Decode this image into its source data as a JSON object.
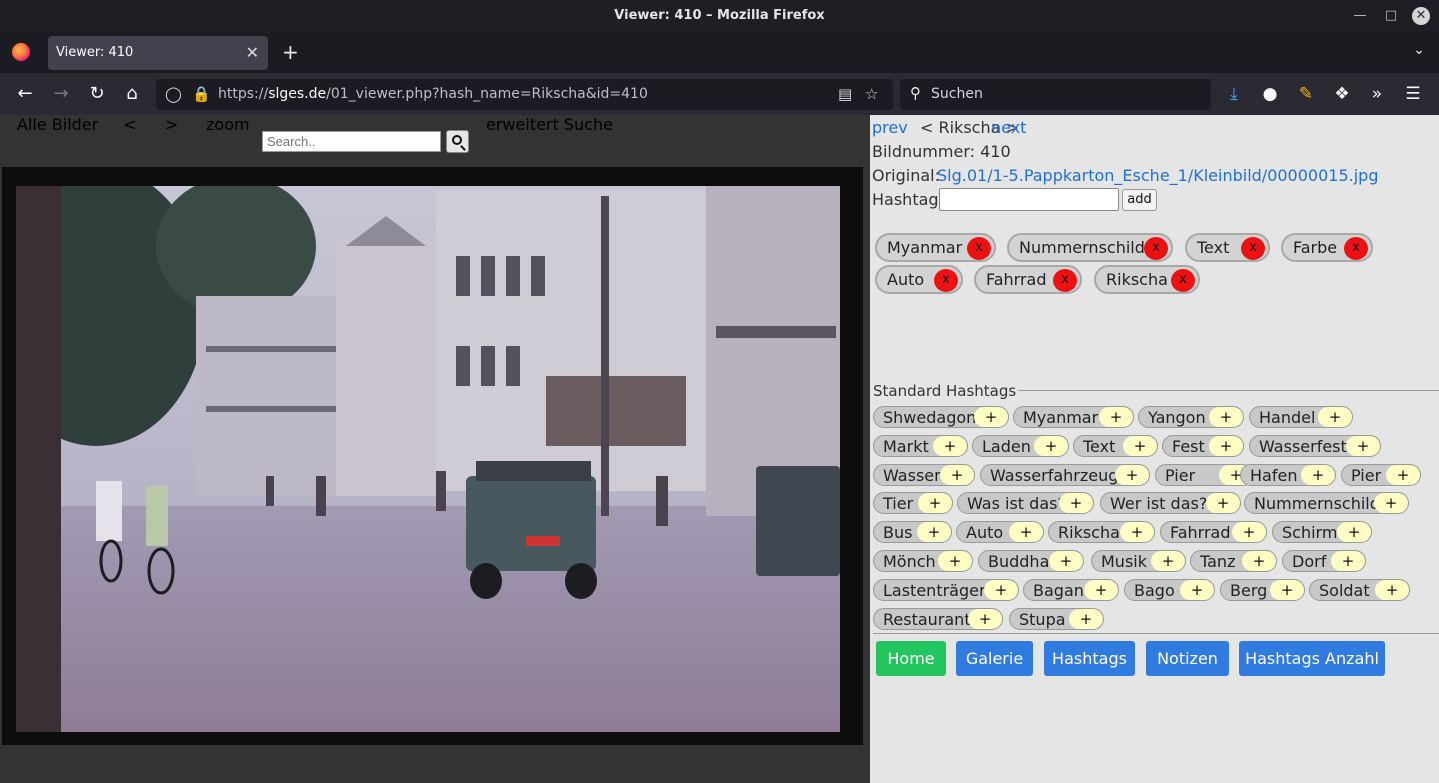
{
  "window": {
    "title": "Viewer: 410 – Mozilla Firefox"
  },
  "tab": {
    "title": "Viewer: 410"
  },
  "address": {
    "prefix": "https://",
    "host": "slges.de",
    "path": "/01_viewer.php?hash_name=Rikscha&id=410"
  },
  "browser_search": {
    "placeholder": "Suchen"
  },
  "site_nav": {
    "all_images": "Alle Bilder",
    "prev_arrow": "<",
    "next_arrow": ">",
    "zoom": "zoom",
    "search_placeholder": "Search..",
    "extended_search": "erweitert Suche"
  },
  "viewer": {
    "prev": "prev",
    "middle": "< Rikscha >",
    "next": "next",
    "number_label": "Bildnummer: 410",
    "original_label": "Original:",
    "original_path": "Slg.01/1-5.Pappkarton_Esche_1/Kleinbild/00000015.jpg",
    "hashtag_label": "Hashtag:",
    "add_label": "add"
  },
  "tags": [
    {
      "label": "Myanmar",
      "remove": "x"
    },
    {
      "label": "Nummernschild",
      "remove": "x"
    },
    {
      "label": "Text",
      "remove": "x"
    },
    {
      "label": "Farbe",
      "remove": "x"
    },
    {
      "label": "Auto",
      "remove": "x"
    },
    {
      "label": "Fahrrad",
      "remove": "x"
    },
    {
      "label": "Rikscha",
      "remove": "x"
    }
  ],
  "standard_hashtags": {
    "legend": "Standard Hashtags",
    "plus": "+",
    "items": [
      "Shwedagon",
      "Myanmar",
      "Yangon",
      "Handel",
      "Markt",
      "Laden",
      "Text",
      "Fest",
      "Wasserfest",
      "Wasser",
      "Wasserfahrzeug",
      "Pier",
      "Hafen",
      "Pier",
      "Tier",
      "Was ist das?",
      "Wer ist das?",
      "Nummernschild",
      "Bus",
      "Auto",
      "Rikscha",
      "Fahrrad",
      "Schirm",
      "Mönch",
      "Buddha",
      "Musik",
      "Tanz",
      "Dorf",
      "Lastenträger",
      "Bagan",
      "Bago",
      "Berg",
      "Soldat",
      "Restaurant",
      "Stupa"
    ]
  },
  "bottom_buttons": [
    {
      "label": "Home",
      "color": "#22c55e"
    },
    {
      "label": "Galerie",
      "color": "#2f7be0"
    },
    {
      "label": "Hashtags",
      "color": "#2f7be0"
    },
    {
      "label": "Notizen",
      "color": "#2f7be0"
    },
    {
      "label": "Hashtags Anzahl",
      "color": "#2f7be0"
    }
  ]
}
